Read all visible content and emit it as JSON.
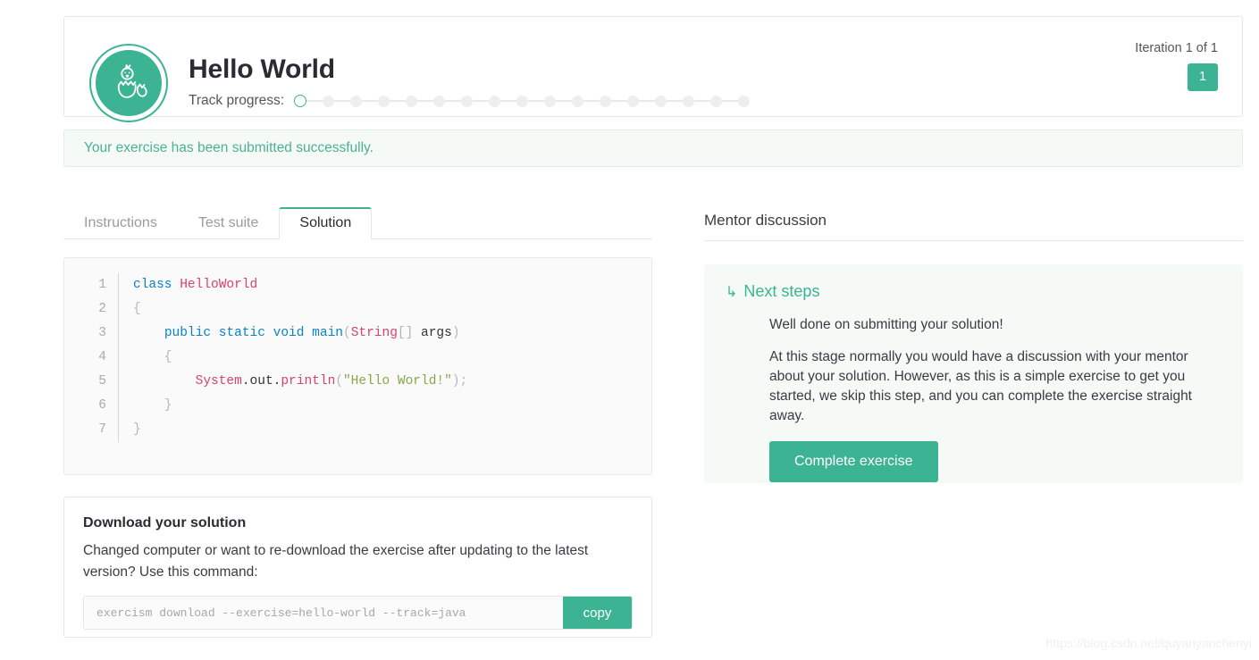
{
  "header": {
    "title": "Hello World",
    "avatar_icon": "hatching-chick-icon",
    "track_progress_label": "Track progress:",
    "progress_total": 17,
    "progress_current": 1,
    "iteration_label": "Iteration 1 of 1",
    "iteration_badge": "1",
    "accent_color": "#3cb493"
  },
  "flash": {
    "message": "Your exercise has been submitted successfully."
  },
  "tabs": [
    {
      "label": "Instructions",
      "active": false
    },
    {
      "label": "Test suite",
      "active": false
    },
    {
      "label": "Solution",
      "active": true
    }
  ],
  "code": {
    "language": "java",
    "lines": [
      {
        "n": "1",
        "tokens": [
          {
            "t": "class",
            "c": "kw"
          },
          {
            "t": " ",
            "c": "id"
          },
          {
            "t": "HelloWorld",
            "c": "type"
          }
        ]
      },
      {
        "n": "2",
        "tokens": [
          {
            "t": "{",
            "c": "pl"
          }
        ]
      },
      {
        "n": "3",
        "tokens": [
          {
            "t": "    ",
            "c": "id"
          },
          {
            "t": "public",
            "c": "kw"
          },
          {
            "t": " ",
            "c": "id"
          },
          {
            "t": "static",
            "c": "kw"
          },
          {
            "t": " ",
            "c": "id"
          },
          {
            "t": "void",
            "c": "kw"
          },
          {
            "t": " ",
            "c": "id"
          },
          {
            "t": "main",
            "c": "kw"
          },
          {
            "t": "(",
            "c": "pl"
          },
          {
            "t": "String",
            "c": "type"
          },
          {
            "t": "[] ",
            "c": "pl"
          },
          {
            "t": "args",
            "c": "id"
          },
          {
            "t": ")",
            "c": "pl"
          }
        ]
      },
      {
        "n": "4",
        "tokens": [
          {
            "t": "    {",
            "c": "pl"
          }
        ]
      },
      {
        "n": "5",
        "tokens": [
          {
            "t": "        ",
            "c": "id"
          },
          {
            "t": "System",
            "c": "fn"
          },
          {
            "t": ".",
            "c": "id"
          },
          {
            "t": "out",
            "c": "id"
          },
          {
            "t": ".",
            "c": "id"
          },
          {
            "t": "println",
            "c": "fn"
          },
          {
            "t": "(",
            "c": "pl"
          },
          {
            "t": "\"Hello World!\"",
            "c": "str"
          },
          {
            "t": ");",
            "c": "pl"
          }
        ]
      },
      {
        "n": "6",
        "tokens": [
          {
            "t": "    }",
            "c": "pl"
          }
        ]
      },
      {
        "n": "7",
        "tokens": [
          {
            "t": "}",
            "c": "pl"
          }
        ]
      }
    ]
  },
  "download": {
    "title": "Download your solution",
    "description": "Changed computer or want to re-download the exercise after updating to the latest version? Use this command:",
    "command": "exercism download --exercise=hello-world --track=java",
    "copy_label": "copy"
  },
  "mentor": {
    "heading": "Mentor discussion",
    "next_steps_arrow": "↳",
    "next_steps_title": "Next steps",
    "paragraphs": [
      "Well done on submitting your solution!",
      "At this stage normally you would have a discussion with your mentor about your solution. However, as this is a simple exercise to get you started, we skip this step, and you can complete the exercise straight away."
    ],
    "complete_button": "Complete exercise"
  },
  "watermark": "https://blog.csdn.net/quyanyanchenyi"
}
